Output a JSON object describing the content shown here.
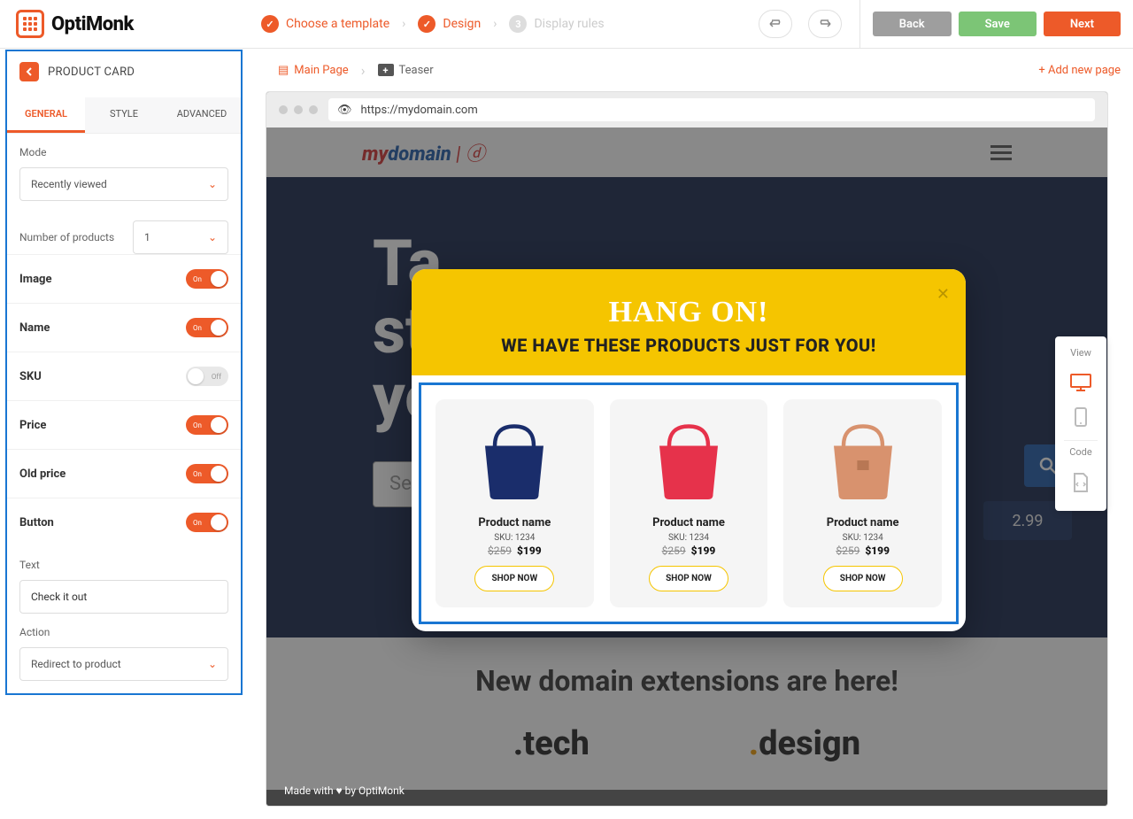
{
  "brand": "OptiMonk",
  "steps": {
    "s1": "Choose a template",
    "s2": "Design",
    "s3": "Display rules",
    "s3num": "3"
  },
  "buttons": {
    "back": "Back",
    "save": "Save",
    "next": "Next"
  },
  "panel": {
    "title": "PRODUCT CARD",
    "tabs": {
      "general": "GENERAL",
      "style": "STYLE",
      "advanced": "ADVANCED"
    },
    "mode_label": "Mode",
    "mode_value": "Recently viewed",
    "nprod_label": "Number of products",
    "nprod_value": "1",
    "toggles": {
      "image": "Image",
      "name": "Name",
      "sku": "SKU",
      "price": "Price",
      "oldprice": "Old price",
      "button": "Button",
      "on": "On",
      "off": "Off"
    },
    "text_label": "Text",
    "text_value": "Check it out",
    "action_label": "Action",
    "action_value": "Redirect to product"
  },
  "crumbs": {
    "main": "Main Page",
    "teaser": "Teaser",
    "add": "+ Add new page",
    "sep": "›"
  },
  "url": "https://mydomain.com",
  "site": {
    "logo_my": "my",
    "logo_dom": "domain",
    "hero": "Talking startup with your",
    "search_ph": "Search",
    "price": "2.99",
    "below_title": "New domain extensions are here!",
    "ext1": ".tech",
    "ext2": "design"
  },
  "popup": {
    "title": "HANG ON!",
    "subtitle": "WE HAVE THESE PRODUCTS JUST FOR YOU!",
    "products": [
      {
        "name": "Product name",
        "sku": "SKU: 1234",
        "old": "$259",
        "new": "$199",
        "cta": "SHOP NOW",
        "color": "#1a2d6b"
      },
      {
        "name": "Product name",
        "sku": "SKU: 1234",
        "old": "$259",
        "new": "$199",
        "cta": "SHOP NOW",
        "color": "#e6324b"
      },
      {
        "name": "Product name",
        "sku": "SKU: 1234",
        "old": "$259",
        "new": "$199",
        "cta": "SHOP NOW",
        "color": "#d8926e"
      }
    ]
  },
  "credit": "Made with ♥ by OptiMonk",
  "view": {
    "label": "View",
    "code": "Code"
  }
}
